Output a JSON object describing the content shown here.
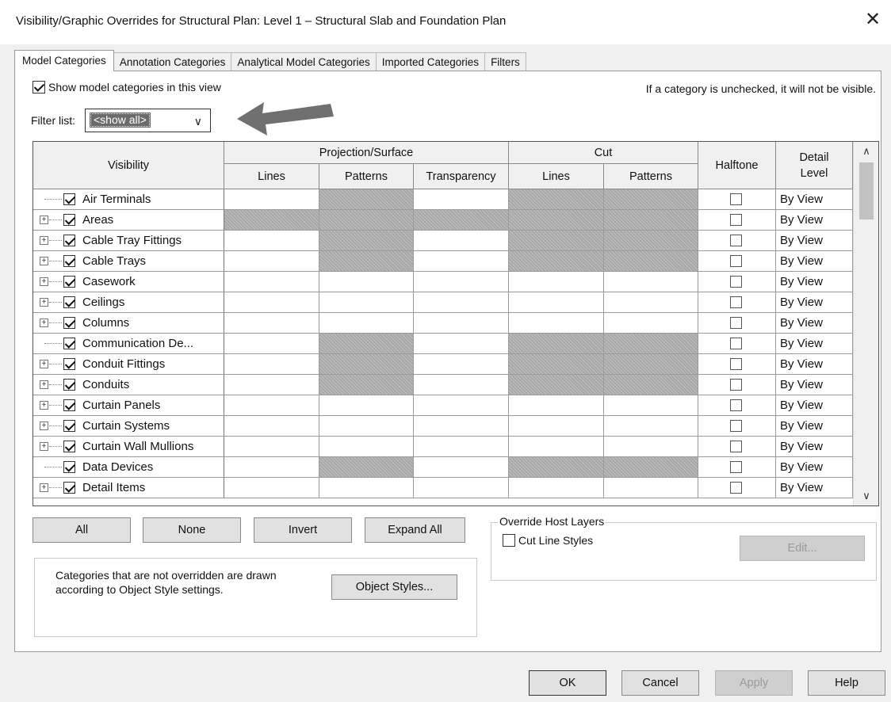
{
  "window": {
    "title": "Visibility/Graphic Overrides for Structural Plan: Level 1 – Structural Slab and Foundation Plan",
    "close_glyph": "✕"
  },
  "tabs": [
    {
      "label": "Model Categories",
      "active": true
    },
    {
      "label": "Annotation Categories",
      "active": false
    },
    {
      "label": "Analytical Model Categories",
      "active": false
    },
    {
      "label": "Imported Categories",
      "active": false
    },
    {
      "label": "Filters",
      "active": false
    }
  ],
  "show_model_categories": {
    "label": "Show model categories in this view",
    "checked": true
  },
  "hint": "If a category is unchecked, it will not be visible.",
  "filter": {
    "label": "Filter list:",
    "value": "<show all>",
    "chevron": "∨"
  },
  "grid": {
    "headers": {
      "visibility": "Visibility",
      "projection_surface": "Projection/Surface",
      "cut": "Cut",
      "halftone": "Halftone",
      "detail_level": "Detail Level",
      "lines": "Lines",
      "patterns": "Patterns",
      "transparency": "Transparency",
      "cut_lines": "Lines",
      "cut_patterns": "Patterns"
    },
    "rows": [
      {
        "name": "Air Terminals",
        "expandable": false,
        "checked": true,
        "hatch": [
          false,
          true,
          false,
          true,
          true
        ],
        "halftone": false,
        "detail": "By View"
      },
      {
        "name": "Areas",
        "expandable": true,
        "checked": true,
        "hatch": [
          true,
          true,
          true,
          true,
          true
        ],
        "halftone": false,
        "detail": "By View"
      },
      {
        "name": "Cable Tray Fittings",
        "expandable": true,
        "checked": true,
        "hatch": [
          false,
          true,
          false,
          true,
          true
        ],
        "halftone": false,
        "detail": "By View"
      },
      {
        "name": "Cable Trays",
        "expandable": true,
        "checked": true,
        "hatch": [
          false,
          true,
          false,
          true,
          true
        ],
        "halftone": false,
        "detail": "By View"
      },
      {
        "name": "Casework",
        "expandable": true,
        "checked": true,
        "hatch": [
          false,
          false,
          false,
          false,
          false
        ],
        "halftone": false,
        "detail": "By View"
      },
      {
        "name": "Ceilings",
        "expandable": true,
        "checked": true,
        "hatch": [
          false,
          false,
          false,
          false,
          false
        ],
        "halftone": false,
        "detail": "By View"
      },
      {
        "name": "Columns",
        "expandable": true,
        "checked": true,
        "hatch": [
          false,
          false,
          false,
          false,
          false
        ],
        "halftone": false,
        "detail": "By View"
      },
      {
        "name": "Communication De...",
        "expandable": false,
        "checked": true,
        "hatch": [
          false,
          true,
          false,
          true,
          true
        ],
        "halftone": false,
        "detail": "By View"
      },
      {
        "name": "Conduit Fittings",
        "expandable": true,
        "checked": true,
        "hatch": [
          false,
          true,
          false,
          true,
          true
        ],
        "halftone": false,
        "detail": "By View"
      },
      {
        "name": "Conduits",
        "expandable": true,
        "checked": true,
        "hatch": [
          false,
          true,
          false,
          true,
          true
        ],
        "halftone": false,
        "detail": "By View"
      },
      {
        "name": "Curtain Panels",
        "expandable": true,
        "checked": true,
        "hatch": [
          false,
          false,
          false,
          false,
          false
        ],
        "halftone": false,
        "detail": "By View"
      },
      {
        "name": "Curtain Systems",
        "expandable": true,
        "checked": true,
        "hatch": [
          false,
          false,
          false,
          false,
          false
        ],
        "halftone": false,
        "detail": "By View"
      },
      {
        "name": "Curtain Wall Mullions",
        "expandable": true,
        "checked": true,
        "hatch": [
          false,
          false,
          false,
          false,
          false
        ],
        "halftone": false,
        "detail": "By View"
      },
      {
        "name": "Data Devices",
        "expandable": false,
        "checked": true,
        "hatch": [
          false,
          true,
          false,
          true,
          true
        ],
        "halftone": false,
        "detail": "By View"
      },
      {
        "name": "Detail Items",
        "expandable": true,
        "checked": true,
        "hatch": [
          false,
          false,
          false,
          false,
          false
        ],
        "halftone": false,
        "detail": "By View"
      }
    ],
    "scroll_up": "∧",
    "scroll_down": "∨"
  },
  "buttons": {
    "all": "All",
    "none": "None",
    "invert": "Invert",
    "expand_all": "Expand All",
    "object_styles": "Object Styles...",
    "edit": "Edit...",
    "ok": "OK",
    "cancel": "Cancel",
    "apply": "Apply",
    "help": "Help"
  },
  "override_host_layers": {
    "title": "Override Host Layers",
    "cut_line_styles": "Cut Line Styles",
    "checked": false
  },
  "note": {
    "line1": "Categories that are not overridden are drawn",
    "line2": "according to Object Style settings."
  }
}
